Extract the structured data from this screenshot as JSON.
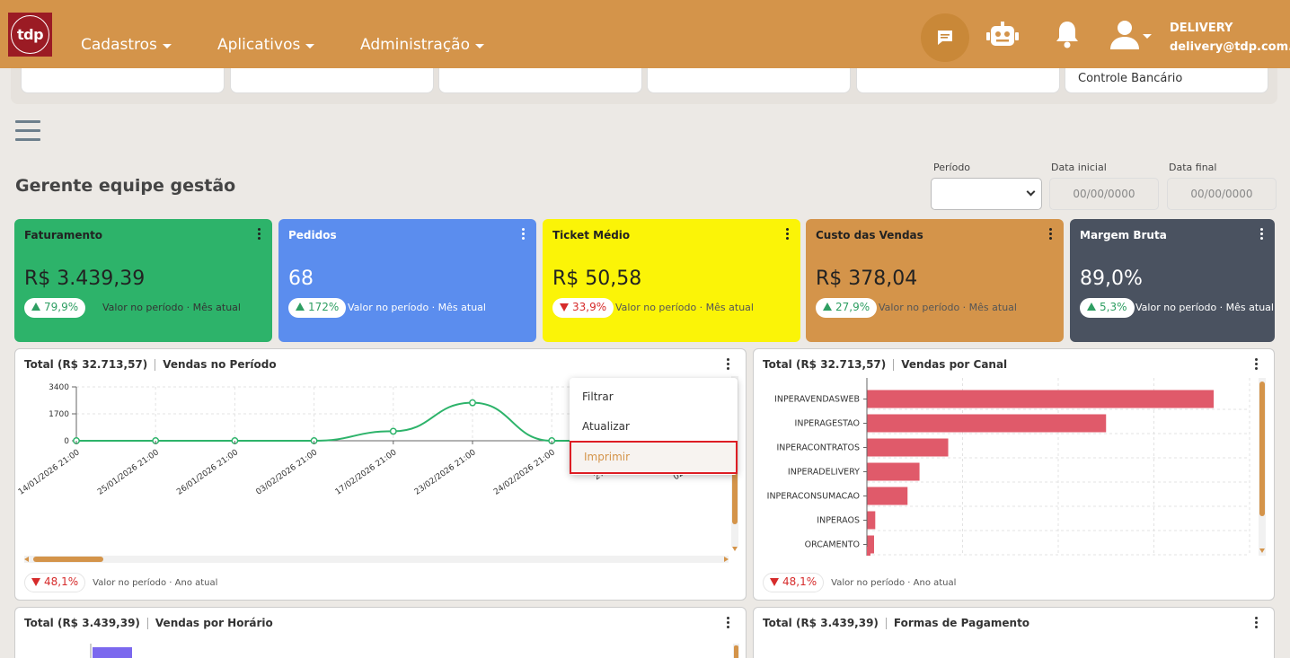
{
  "app": {
    "logo_text": "tdp",
    "menus": [
      "Cadastros",
      "Aplicativos",
      "Administração"
    ],
    "user_name": "DELIVERY",
    "user_email": "delivery@tdp.com.br"
  },
  "shortcuts": [
    "",
    "",
    "",
    "",
    "",
    "Controle Bancário"
  ],
  "page_title": "Gerente equipe gestão",
  "filters": {
    "periodo_label": "Período",
    "periodo_value": "",
    "data_inicial_label": "Data inicial",
    "data_inicial_placeholder": "00/00/0000",
    "data_final_label": "Data final",
    "data_final_placeholder": "00/00/0000"
  },
  "kpis": [
    {
      "title": "Faturamento",
      "value": "R$ 3.439,39",
      "change": "79,9%",
      "direction": "up",
      "sub": "Valor no período · Mês atual",
      "color": "#2db36a"
    },
    {
      "title": "Pedidos",
      "value": "68",
      "change": "172%",
      "direction": "up",
      "sub": "Valor no período · Mês atual",
      "color": "#5b8dee"
    },
    {
      "title": "Ticket Médio",
      "value": "R$ 50,58",
      "change": "33,9%",
      "direction": "down",
      "sub": "Valor no período · Mês atual",
      "color": "#fbf407"
    },
    {
      "title": "Custo das Vendas",
      "value": "R$ 378,04",
      "change": "27,9%",
      "direction": "up",
      "sub": "Valor no período · Mês atual",
      "color": "#d4944a"
    },
    {
      "title": "Margem Bruta",
      "value": "89,0%",
      "change": "5,3%",
      "direction": "up",
      "sub": "Valor no período · Mês atual",
      "color": "#4a5260"
    }
  ],
  "panels": {
    "vendas_periodo": {
      "total": "Total (R$ 32.713,57)",
      "title": "Vendas no Período",
      "foot_change": "48,1%",
      "foot_sub": "Valor no período · Ano atual"
    },
    "vendas_canal": {
      "total": "Total (R$ 32.713,57)",
      "title": "Vendas por Canal",
      "foot_change": "48,1%",
      "foot_sub": "Valor no período · Ano atual"
    },
    "vendas_horario": {
      "total": "Total (R$ 3.439,39)",
      "title": "Vendas por Horário"
    },
    "formas_pagamento": {
      "total": "Total (R$ 3.439,39)",
      "title": "Formas de Pagamento"
    }
  },
  "dropdown": {
    "items": [
      "Filtrar",
      "Atualizar",
      "Imprimir"
    ],
    "active": "Imprimir"
  },
  "chart_data": [
    {
      "type": "line",
      "title": "Vendas no Período",
      "x": [
        "14/01/2026 21:00",
        "25/01/2026 21:00",
        "26/01/2026 21:00",
        "03/02/2026 21:00",
        "17/02/2026 21:00",
        "23/02/2026 21:00",
        "24/02/2026 21:00",
        "27/02/2026",
        "02/03/2026"
      ],
      "y": [
        0,
        0,
        0,
        0,
        600,
        2400,
        0,
        null,
        null
      ],
      "yticks": [
        0,
        1700,
        3400
      ],
      "ylim": [
        0,
        3400
      ],
      "color": "#2db36a",
      "grid": true
    },
    {
      "type": "bar",
      "orientation": "horizontal",
      "title": "Vendas por Canal",
      "categories": [
        "INPERAVENDASWEB",
        "INPERAGESTAO",
        "INPERACONTRATOS",
        "INPERADELIVERY",
        "INPERACONSUMACAO",
        "INPERAOS",
        "ORCAMENTO"
      ],
      "values": [
        14500,
        10000,
        3400,
        2200,
        1700,
        350,
        300
      ],
      "xlim": [
        0,
        16000
      ],
      "color": "#e05a6a",
      "grid": true
    },
    {
      "type": "bar",
      "title": "Vendas por Horário",
      "color": "#7b68ee"
    }
  ]
}
